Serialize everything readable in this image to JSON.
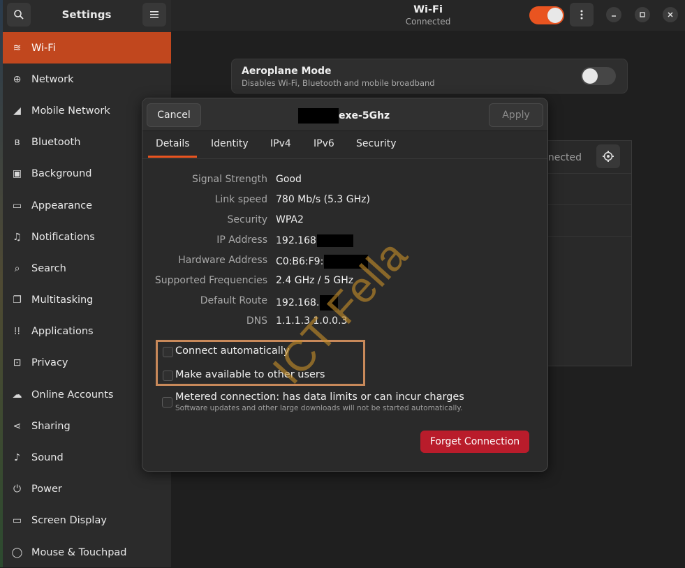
{
  "sidebar": {
    "title": "Settings",
    "search_icon": "search-icon",
    "menu_icon": "hamburger-icon",
    "items": [
      {
        "label": "Wi-Fi",
        "icon": "wifi-icon",
        "glyph": "≋"
      },
      {
        "label": "Network",
        "icon": "globe-icon",
        "glyph": "⊕"
      },
      {
        "label": "Mobile Network",
        "icon": "signal-icon",
        "glyph": "◢"
      },
      {
        "label": "Bluetooth",
        "icon": "bluetooth-icon",
        "glyph": "ʙ"
      },
      {
        "label": "Background",
        "icon": "image-icon",
        "glyph": "▣"
      },
      {
        "label": "Appearance",
        "icon": "display-icon",
        "glyph": "▭"
      },
      {
        "label": "Notifications",
        "icon": "bell-icon",
        "glyph": "♫"
      },
      {
        "label": "Search",
        "icon": "search-icon",
        "glyph": "⌕"
      },
      {
        "label": "Multitasking",
        "icon": "multitasking-icon",
        "glyph": "❐"
      },
      {
        "label": "Applications",
        "icon": "grid-icon",
        "glyph": "⁞⁞"
      },
      {
        "label": "Privacy",
        "icon": "lock-icon",
        "glyph": "⊡"
      },
      {
        "label": "Online Accounts",
        "icon": "cloud-icon",
        "glyph": "☁"
      },
      {
        "label": "Sharing",
        "icon": "share-icon",
        "glyph": "⋖"
      },
      {
        "label": "Sound",
        "icon": "music-note-icon",
        "glyph": "♪"
      },
      {
        "label": "Power",
        "icon": "power-icon",
        "glyph": "⏻"
      },
      {
        "label": "Screen Display",
        "icon": "monitor-icon",
        "glyph": "▭"
      },
      {
        "label": "Mouse & Touchpad",
        "icon": "mouse-icon",
        "glyph": "◯"
      }
    ]
  },
  "header": {
    "title": "Wi-Fi",
    "subtitle": "Connected",
    "wifi_toggle_on": true,
    "accent": "#e95420"
  },
  "main": {
    "aeroplane_title": "Aeroplane Mode",
    "aeroplane_subtitle": "Disables Wi-Fi, Bluetooth and mobile broadband",
    "network_status_partial": "nnected"
  },
  "dialog": {
    "cancel_label": "Cancel",
    "title_suffix": "exe-5Ghz",
    "apply_label": "Apply",
    "tabs": [
      "Details",
      "Identity",
      "IPv4",
      "IPv6",
      "Security"
    ],
    "active_tab": "Details",
    "details": [
      {
        "label": "Signal Strength",
        "value": "Good"
      },
      {
        "label": "Link speed",
        "value": "780 Mb/s (5.3 GHz)"
      },
      {
        "label": "Security",
        "value": "WPA2"
      },
      {
        "label": "IP Address",
        "value": "192.168"
      },
      {
        "label": "Hardware Address",
        "value": "C0:B6:F9:"
      },
      {
        "label": "Supported Frequencies",
        "value": "2.4 GHz / 5 GHz"
      },
      {
        "label": "Default Route",
        "value": "192.168."
      },
      {
        "label": "DNS",
        "value": "1.1.1.3 1.0.0.3"
      }
    ],
    "connect_auto_label": "Connect automatically",
    "available_users_label": "Make available to other users",
    "metered_label": "Metered connection: has data limits or can incur charges",
    "metered_sub": "Software updates and other large downloads will not be started automatically.",
    "forget_label": "Forget Connection",
    "danger_color": "#b91c2b"
  },
  "watermark": "ICT Fella"
}
